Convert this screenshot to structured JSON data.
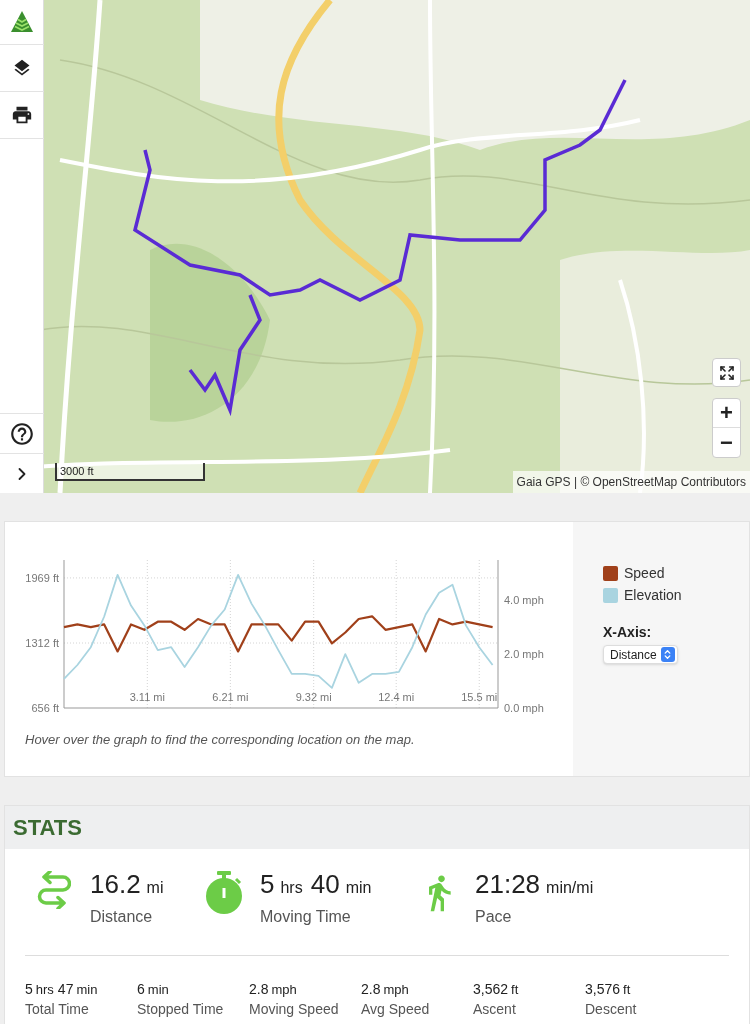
{
  "sidebar": {
    "top_tools": [
      {
        "kind": "logo"
      },
      {
        "kind": "layers"
      },
      {
        "kind": "print"
      }
    ],
    "bottom_tools": [
      {
        "kind": "help"
      },
      {
        "kind": "expand"
      }
    ]
  },
  "map": {
    "scale": "3000 ft",
    "attribution": "Gaia GPS | © OpenStreetMap Contributors",
    "zoom_in": "+",
    "zoom_out": "−"
  },
  "chart": {
    "chart_data": {
      "type": "line",
      "grid": true,
      "xlim": [
        0,
        16.2
      ],
      "ylim": [
        656,
        2150
      ],
      "y2lim": [
        0,
        5.49
      ],
      "x": [
        0,
        0.5,
        1,
        1.5,
        2,
        2.5,
        3,
        3.5,
        4,
        4.5,
        5,
        5.5,
        6,
        6.5,
        7,
        7.5,
        8,
        8.5,
        9,
        9.5,
        10,
        10.5,
        11,
        11.5,
        12,
        12.5,
        13,
        13.5,
        14,
        14.5,
        15,
        15.5,
        16
      ],
      "xticks": [
        {
          "value": 3.11,
          "label": "3.11 mi"
        },
        {
          "value": 6.21,
          "label": "6.21 mi"
        },
        {
          "value": 9.32,
          "label": "9.32 mi"
        },
        {
          "value": 12.4,
          "label": "12.4 mi"
        },
        {
          "value": 15.5,
          "label": "15.5 mi"
        }
      ],
      "yticks": [
        {
          "value": 656,
          "label": "656 ft"
        },
        {
          "value": 1312,
          "label": "1312 ft"
        },
        {
          "value": 1969,
          "label": "1969 ft"
        }
      ],
      "y2ticks": [
        {
          "value": 0,
          "label": "0.0 mph"
        },
        {
          "value": 2,
          "label": "2.0 mph"
        },
        {
          "value": 4,
          "label": "4.0 mph"
        }
      ],
      "series": [
        {
          "name": "Speed",
          "color": "#a0401a",
          "axis": "y2",
          "values": [
            3.0,
            3.1,
            3.0,
            3.1,
            2.1,
            3.1,
            2.9,
            3.2,
            3.2,
            2.9,
            3.3,
            3.1,
            3.1,
            2.1,
            3.1,
            3.1,
            3.1,
            2.5,
            3.2,
            3.2,
            2.4,
            2.8,
            3.3,
            3.4,
            2.9,
            3.0,
            3.1,
            2.1,
            3.3,
            3.1,
            3.2,
            3.1,
            3.0
          ]
        },
        {
          "name": "Elevation",
          "color": "#a9d4e0",
          "values": [
            950,
            1090,
            1270,
            1580,
            2000,
            1690,
            1490,
            1240,
            1270,
            1070,
            1270,
            1490,
            1650,
            2000,
            1710,
            1490,
            1240,
            1000,
            1000,
            980,
            860,
            1200,
            910,
            1000,
            1000,
            1020,
            1270,
            1600,
            1820,
            1900,
            1490,
            1270,
            1090
          ]
        }
      ]
    },
    "hint": "Hover over the graph to find the corresponding location on the map.",
    "x_axis": {
      "label": "X-Axis:",
      "value": "Distance"
    }
  },
  "stats": {
    "title": "STATS",
    "main": [
      {
        "kind": "distance",
        "parts": [
          {
            "value": "16.2",
            "unit": "mi"
          }
        ],
        "label": "Distance"
      },
      {
        "kind": "timer",
        "parts": [
          {
            "value": "5",
            "unit": "hrs"
          },
          {
            "value": "40",
            "unit": "min"
          }
        ],
        "label": "Moving Time"
      },
      {
        "kind": "walk",
        "parts": [
          {
            "value": "21:28",
            "unit": "min/mi"
          }
        ],
        "label": "Pace"
      }
    ],
    "details": [
      {
        "parts": [
          {
            "value": "5",
            "unit": "hrs"
          },
          {
            "value": "47",
            "unit": "min"
          }
        ],
        "label": "Total Time"
      },
      {
        "parts": [
          {
            "value": "6",
            "unit": "min"
          }
        ],
        "label": "Stopped Time"
      },
      {
        "parts": [
          {
            "value": "2.8",
            "unit": "mph"
          }
        ],
        "label": "Moving Speed"
      },
      {
        "parts": [
          {
            "value": "2.8",
            "unit": "mph"
          }
        ],
        "label": "Avg Speed"
      },
      {
        "parts": [
          {
            "value": "3,562",
            "unit": "ft"
          }
        ],
        "label": "Ascent"
      },
      {
        "parts": [
          {
            "value": "3,576",
            "unit": "ft"
          }
        ],
        "label": "Descent"
      }
    ]
  }
}
